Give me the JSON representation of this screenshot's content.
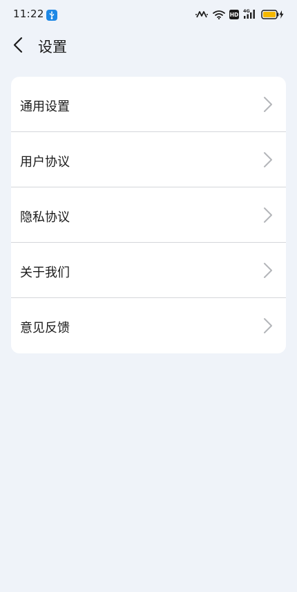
{
  "status_bar": {
    "time": "11:22",
    "icons": [
      "usb-debugging-icon",
      "nfc-icon",
      "wifi-icon",
      "hd-icon",
      "signal-4g-icon",
      "battery-charging-icon"
    ],
    "hd_label": "HD",
    "network_label": "4G"
  },
  "header": {
    "title": "设置",
    "back_icon": "back-arrow-icon"
  },
  "settings": {
    "items": [
      {
        "label": "通用设置"
      },
      {
        "label": "用户协议"
      },
      {
        "label": "隐私协议"
      },
      {
        "label": "关于我们"
      },
      {
        "label": "意见反馈"
      }
    ]
  },
  "colors": {
    "background": "#eff3f9",
    "card": "#ffffff",
    "divider": "#d4d6da",
    "chevron": "#b3b5b9",
    "usb_badge": "#1e88e5",
    "battery": "#f5b800"
  }
}
